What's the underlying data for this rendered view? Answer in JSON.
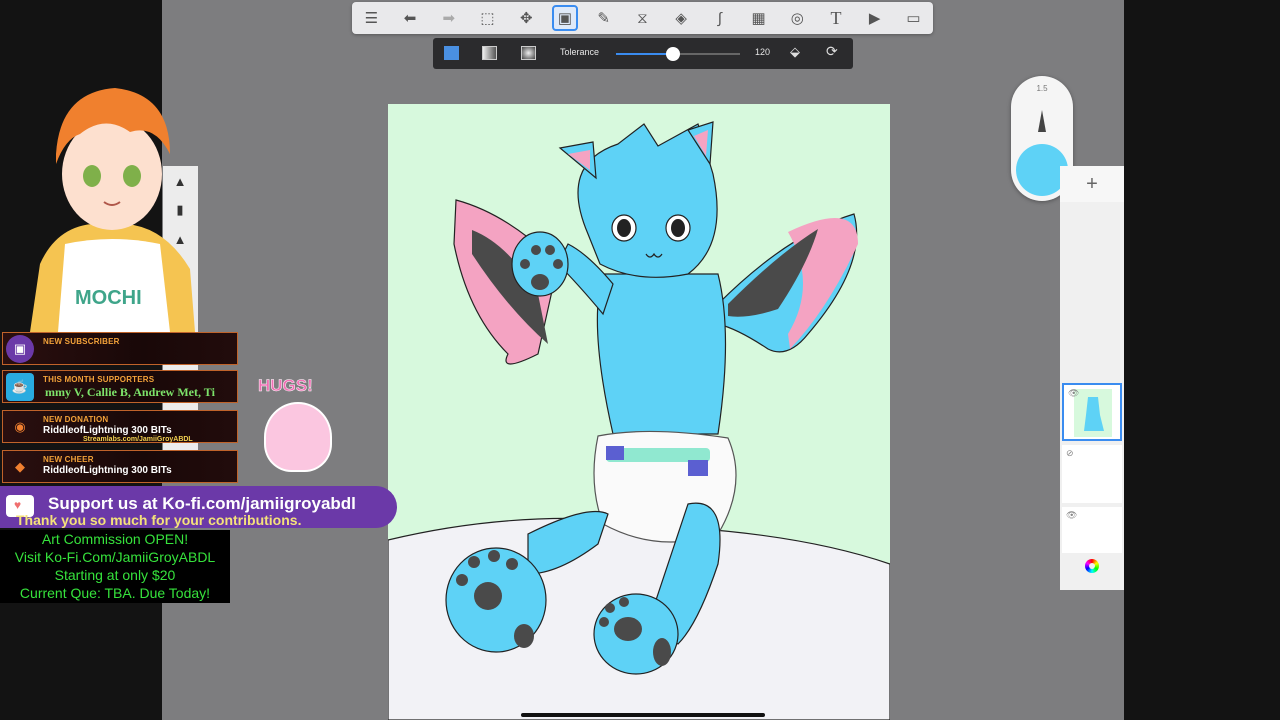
{
  "toolbar": {
    "items": [
      "gallery",
      "undo",
      "redo",
      "selection",
      "transform",
      "fill",
      "eraser",
      "symmetry",
      "shapes",
      "curve",
      "image",
      "perspective",
      "text",
      "video",
      "fullscreen"
    ]
  },
  "fill_bar": {
    "tolerance_label": "Tolerance",
    "tolerance_value": "120",
    "tolerance_fraction": 0.46
  },
  "brush": {
    "size": "1.5",
    "color": "#5ed2f6"
  },
  "layers": {
    "add": "+"
  },
  "stream": {
    "hugs_label": "HUGS!",
    "alerts": [
      {
        "title": "NEW SUBSCRIBER",
        "text": "",
        "sub": ""
      },
      {
        "title": "THIS MONTH SUPPORTERS",
        "text": "mmy V, Callie B, Andrew Met, Ti",
        "sub": ""
      },
      {
        "title": "NEW DONATION",
        "text": "RiddleofLightning 300 BITs",
        "sub": "Streamlabs.com/JamiiGroyABDL"
      },
      {
        "title": "NEW CHEER",
        "text": "RiddleofLightning 300 BITs",
        "sub": ""
      }
    ],
    "kofi": {
      "line1": "Support us at Ko-fi.com/jamiigroyabdl",
      "line2": "Thank you so much for your contributions."
    },
    "commission": [
      "Art Commission OPEN!",
      "Visit Ko-Fi.Com/JamiiGroyABDL",
      "Starting at only $20",
      "Current Que: TBA. Due Today!"
    ]
  },
  "colors": {
    "accent": "#3a8cf0",
    "character_blue": "#5ed2f6",
    "canvas_bg": "#d7f9dd",
    "wing_pink": "#f4a3c2",
    "commission_text": "#36e23c",
    "kofi_purple": "#6b39a8"
  }
}
